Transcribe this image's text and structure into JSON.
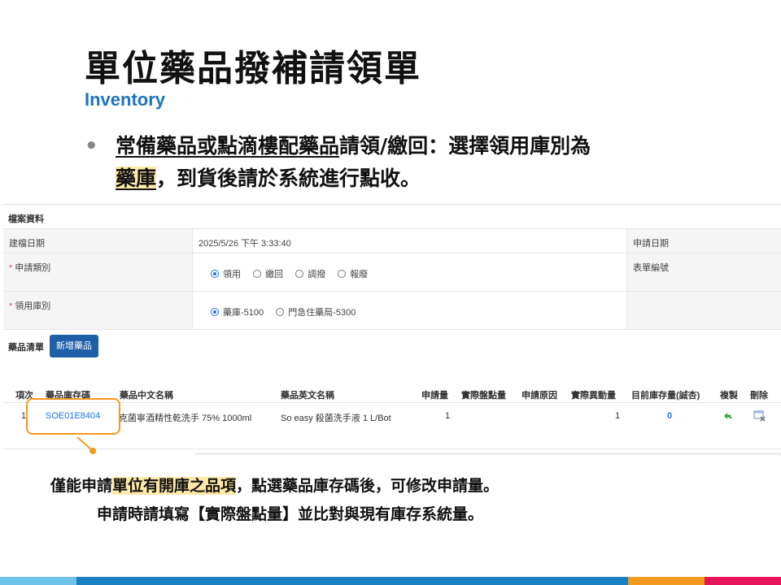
{
  "slide": {
    "title": "單位藥品撥補請領單",
    "subtitle": "Inventory",
    "bullet": {
      "part1_underlined": "常備藥品或點滴樓配藥品",
      "part2": "請領/繳回：選擇領用庫別為",
      "part3_highlight": "藥庫",
      "part4": "，到貨後請於系統進行點收。"
    },
    "footer_line1": {
      "pre": "僅能申請",
      "highlight": "單位有開庫之品項",
      "post": "，點選藥品庫存碼後，可修改申請量。"
    },
    "footer_line2": "申請時請填寫【實際盤點量】並比對與現有庫存系統量。",
    "colors": {
      "title_blue": "#1e73be",
      "highlight": "#ffe9a8",
      "callout": "#f39a1e"
    }
  },
  "form": {
    "section_title": "檔案資料",
    "created_date": {
      "label": "建檔日期",
      "value": "2025/5/26 下午 3:33:40"
    },
    "apply_date": {
      "label": "申請日期"
    },
    "form_no": {
      "label": "表單編號"
    },
    "apply_type": {
      "label": "申請類別",
      "required_mark": "*",
      "options": [
        "領用",
        "繳回",
        "調撥",
        "報廢"
      ],
      "selected": "領用"
    },
    "warehouse": {
      "label": "領用庫別",
      "required_mark": "*",
      "options": [
        "藥庫-5100",
        "門急住藥局-5300"
      ],
      "selected": "藥庫-5100"
    }
  },
  "medlist": {
    "title": "藥品清單",
    "add_button": "新增藥品",
    "columns": [
      "項次",
      "藥品庫存碼",
      "藥品中文名稱",
      "藥品英文名稱",
      "申請量",
      "實際盤點量",
      "申請原因",
      "實際異動量",
      "目前庫存量(誠杏)",
      "複製",
      "刪除"
    ],
    "rows": [
      {
        "index": "1",
        "code": "SOE01E8404",
        "name_zh": "克菌寧酒精性乾洗手 75% 1000ml",
        "name_en": "So easy 殺菌洗手液 1 L/Bot",
        "apply_qty": "1",
        "count_qty": "",
        "reason": "",
        "actual_qty": "1",
        "stock": "0"
      }
    ]
  }
}
